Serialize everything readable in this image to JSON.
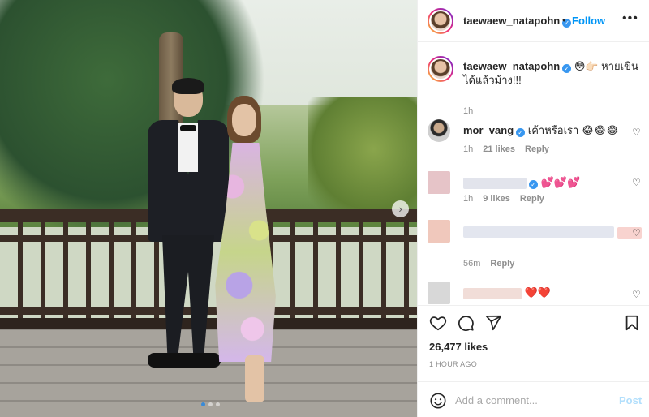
{
  "post": {
    "author": "taewaew_natapohn",
    "follow_label": "Follow",
    "separator": "•",
    "more_label": "•••"
  },
  "caption": {
    "username": "taewaew_natapohn",
    "text": "😳👉🏻 หายเขินได้แล้วม้าง!!!",
    "time": "1h"
  },
  "comments": [
    {
      "username": "mor_vang",
      "text": "เค้าหรือเรา 😂😂😂",
      "time": "1h",
      "likes": "21 likes",
      "reply": "Reply"
    },
    {
      "username": "",
      "text": "💕💕💕",
      "time": "1h",
      "likes": "9 likes",
      "reply": "Reply"
    },
    {
      "username": "",
      "text": "",
      "time": "56m",
      "likes": "",
      "reply": "Reply"
    },
    {
      "username": "",
      "text": "❤️❤️",
      "time": "",
      "likes": "",
      "reply": ""
    }
  ],
  "stats": {
    "likes": "26,477 likes",
    "posted": "1 HOUR AGO"
  },
  "composer": {
    "placeholder": "Add a comment...",
    "post_label": "Post"
  },
  "carousel": {
    "next_glyph": "›",
    "dot_count": 3,
    "active_dot": 0
  },
  "colors": {
    "accent": "#0095f6",
    "post_disabled": "#b2dffc",
    "verified": "#3897f0",
    "meta": "#8e8e8e"
  },
  "icons": {
    "verified": "verified-badge-icon",
    "like": "heart-icon",
    "comment": "comment-icon",
    "share": "share-icon",
    "save": "bookmark-icon",
    "emoji": "emoji-icon",
    "more": "more-options-icon",
    "next": "chevron-right-icon"
  }
}
